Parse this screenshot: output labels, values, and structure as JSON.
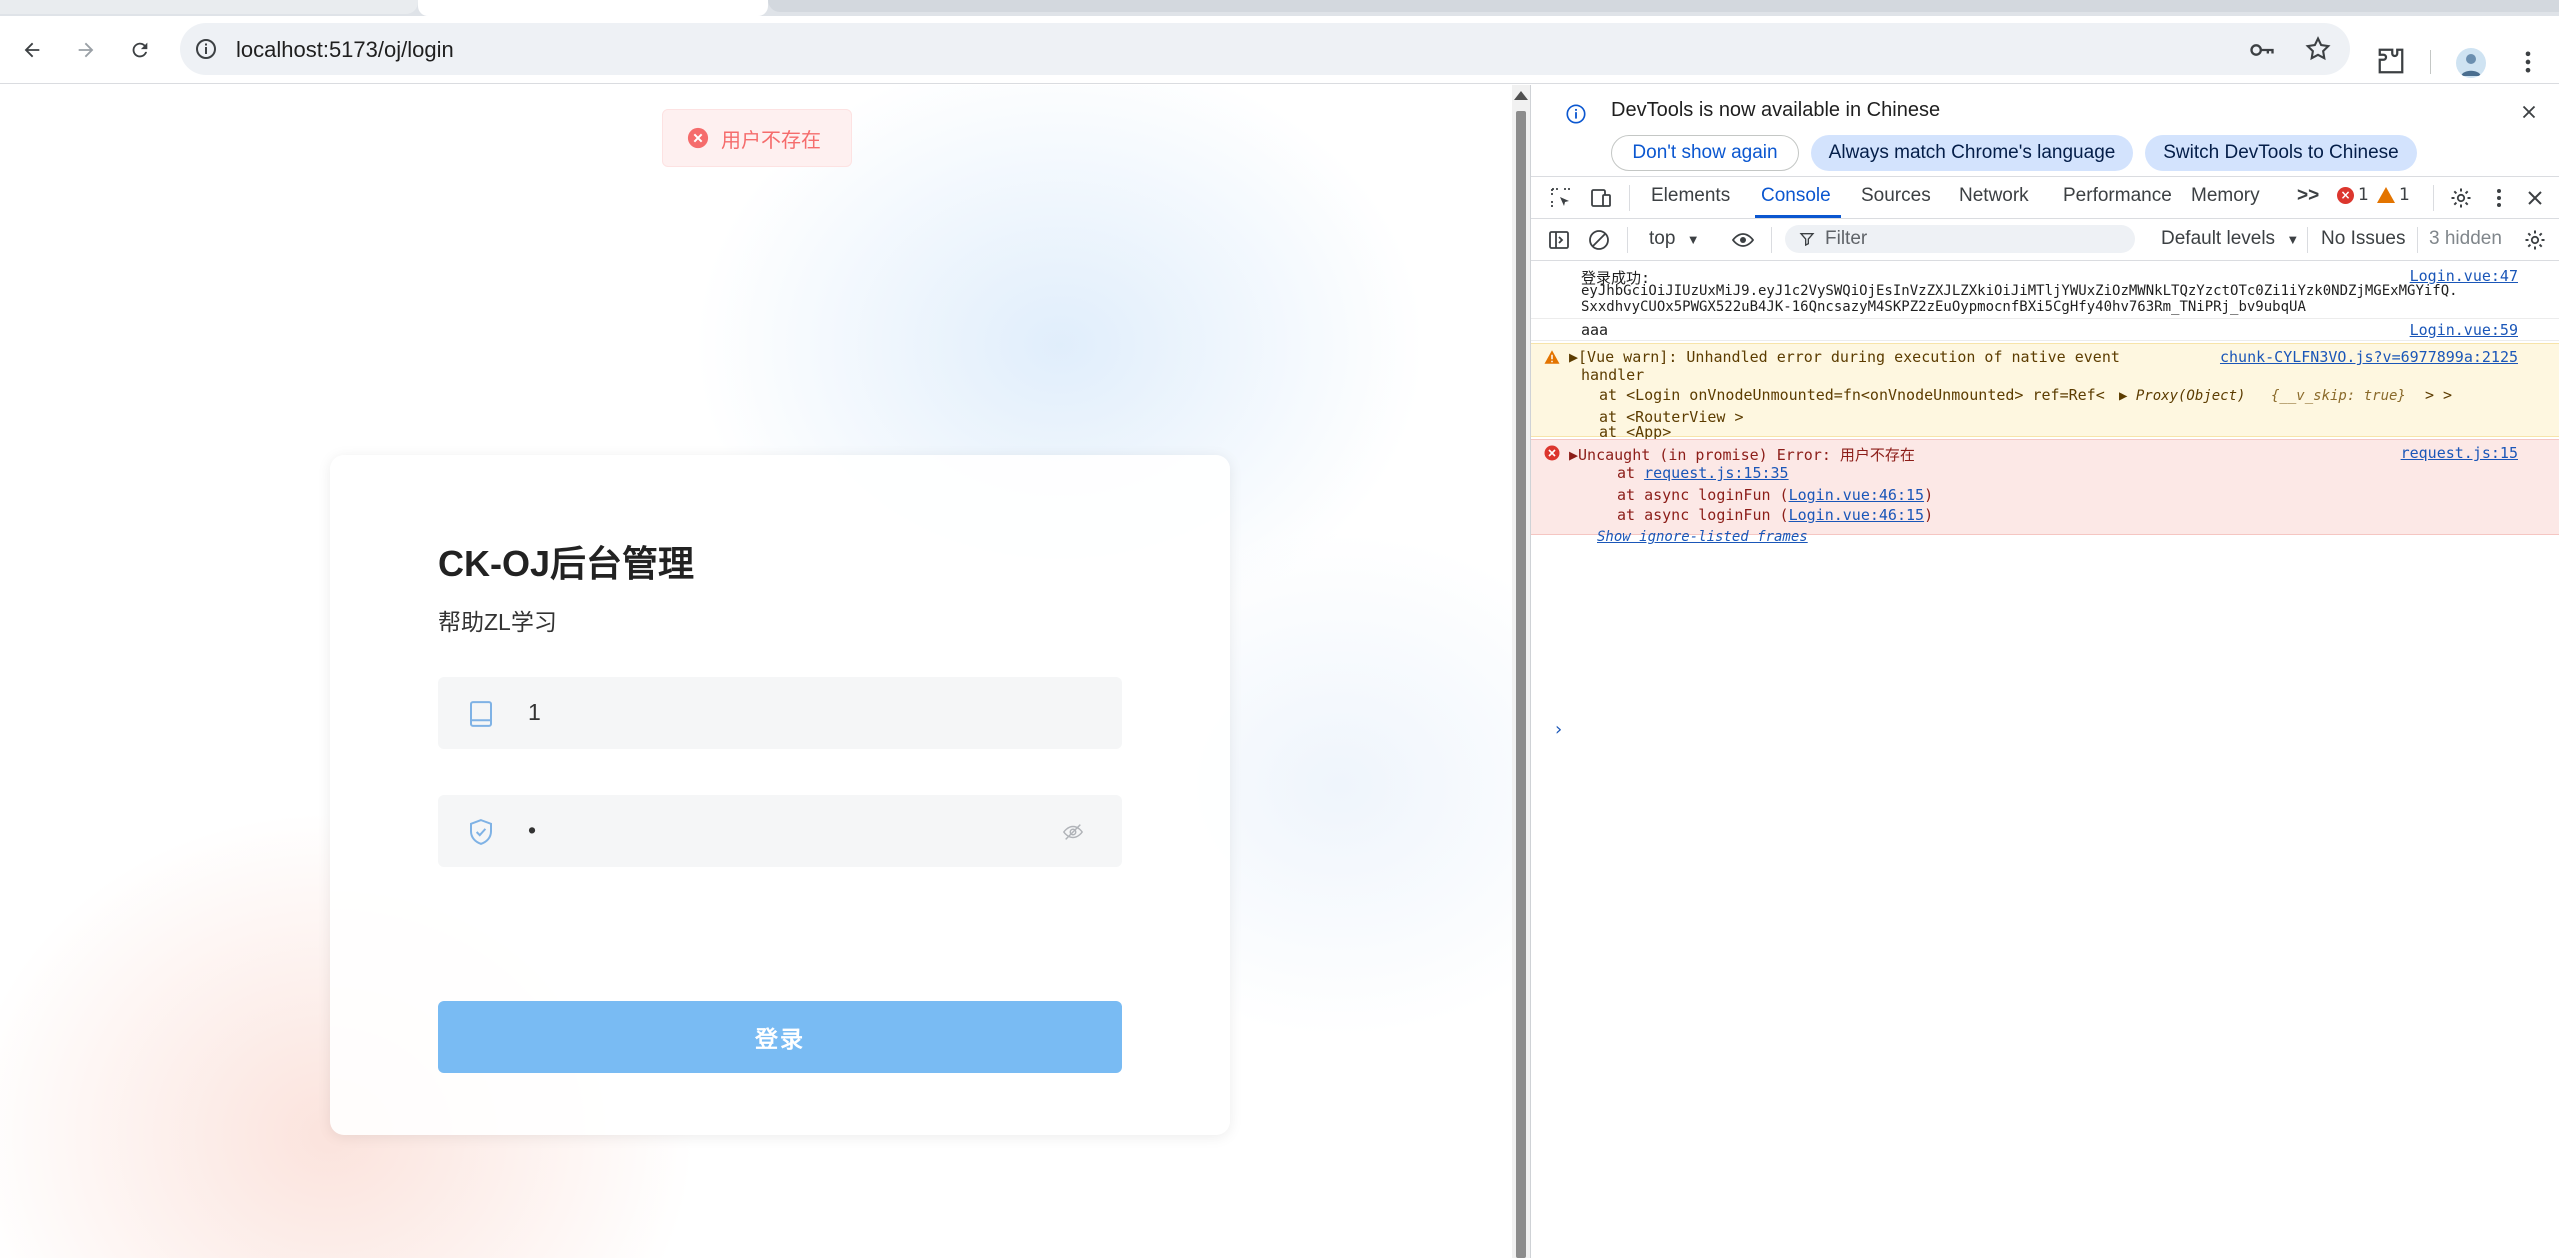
{
  "browser": {
    "url": "localhost:5173/oj/login"
  },
  "page": {
    "toast_message": "用户不存在",
    "card_title": "CK-OJ后台管理",
    "card_subtitle": "帮助ZL学习",
    "account_value": "1",
    "password_value": "•",
    "login_button": "登录",
    "colors": {
      "primary_button": "#79bbf3",
      "error_text": "#f56c6c"
    }
  },
  "devtools": {
    "banner_text": "DevTools is now available in Chinese",
    "banner_buttons": [
      "Don't show again",
      "Always match Chrome's language",
      "Switch DevTools to Chinese"
    ],
    "tabs": [
      "Elements",
      "Console",
      "Sources",
      "Network",
      "Performance",
      "Memory"
    ],
    "more_tabs": ">>",
    "error_count": "1",
    "warning_count": "1",
    "context": "top",
    "filter_placeholder": "Filter",
    "levels": "Default levels",
    "issues": "No Issues",
    "hidden": "3 hidden",
    "console": {
      "log1": {
        "label": "登录成功:",
        "token_line1": "eyJhbGciOiJIUzUxMiJ9.eyJ1c2VySWQiOjEsInVzZXJLZXkiOiJiMTljYWUxZiOzMWNkLTQzYzctOTc0Zi1iYzk0NDZjMGExMGYifQ.",
        "token_line2": "SxxdhvyCUOx5PWGX522uB4JK-16QncsazyM4SKPZ2zEuOypmocnfBXi5CgHfy40hv763Rm_TNiPRj_bv9ubqUA",
        "source": "Login.vue:47"
      },
      "log2": {
        "text": "aaa",
        "source": "Login.vue:59"
      },
      "warn": {
        "line1": "▶[Vue warn]: Unhandled error during execution of native event",
        "line2": "handler",
        "line3a": "at <Login onVnodeUnmounted=fn<onVnodeUnmounted> ref=Ref<",
        "line3b": "▶ Proxy(Object)",
        "line3c": "{__v_skip: true}",
        "line3d": "> >",
        "line4": "at <RouterView >",
        "line5": "at <App>",
        "source": "chunk-CYLFN3VO.js?v=6977899a:2125"
      },
      "error": {
        "line1": "▶Uncaught (in promise) Error: 用户不存在",
        "line2_prefix": "at ",
        "line2_link": "request.js:15:35",
        "line3_prefix": "at async loginFun (",
        "line3_link": "Login.vue:46:15",
        "line3_suffix": ")",
        "line4_prefix": "at async loginFun (",
        "line4_link": "Login.vue:46:15",
        "line4_suffix": ")",
        "ignore_link": "Show ignore-listed frames",
        "source": "request.js:15"
      },
      "prompt": "›"
    }
  }
}
